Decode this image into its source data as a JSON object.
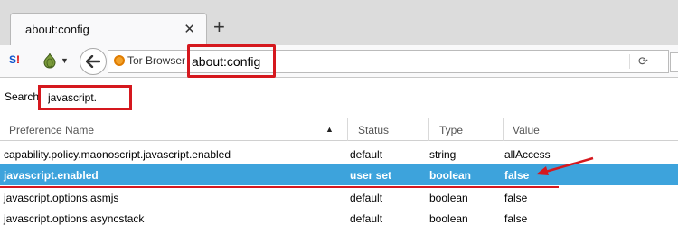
{
  "tab": {
    "title": "about:config",
    "close_glyph": "✕"
  },
  "new_tab_glyph": "+",
  "navbar": {
    "ext1_icon": "su-extension-icon",
    "ext2_icon": "onion-extension-icon",
    "back_glyph": "🡐",
    "identity_label": "Tor Browser",
    "url": "about:config",
    "reload_glyph": "⟳"
  },
  "search": {
    "label": "Search:",
    "value": "javascript."
  },
  "table": {
    "headers": {
      "name": "Preference Name",
      "status": "Status",
      "type": "Type",
      "value": "Value"
    },
    "rows": [
      {
        "name": "capability.policy.maonoscript.javascript.enabled",
        "status": "default",
        "type": "string",
        "value": "allAccess"
      },
      {
        "name": "javascript.enabled",
        "status": "user set",
        "type": "boolean",
        "value": "false"
      },
      {
        "name": "javascript.options.asmjs",
        "status": "default",
        "type": "boolean",
        "value": "false"
      },
      {
        "name": "javascript.options.asyncstack",
        "status": "default",
        "type": "boolean",
        "value": "false"
      }
    ]
  },
  "colors": {
    "selection": "#3da3dc",
    "annotation": "#d5181e"
  }
}
